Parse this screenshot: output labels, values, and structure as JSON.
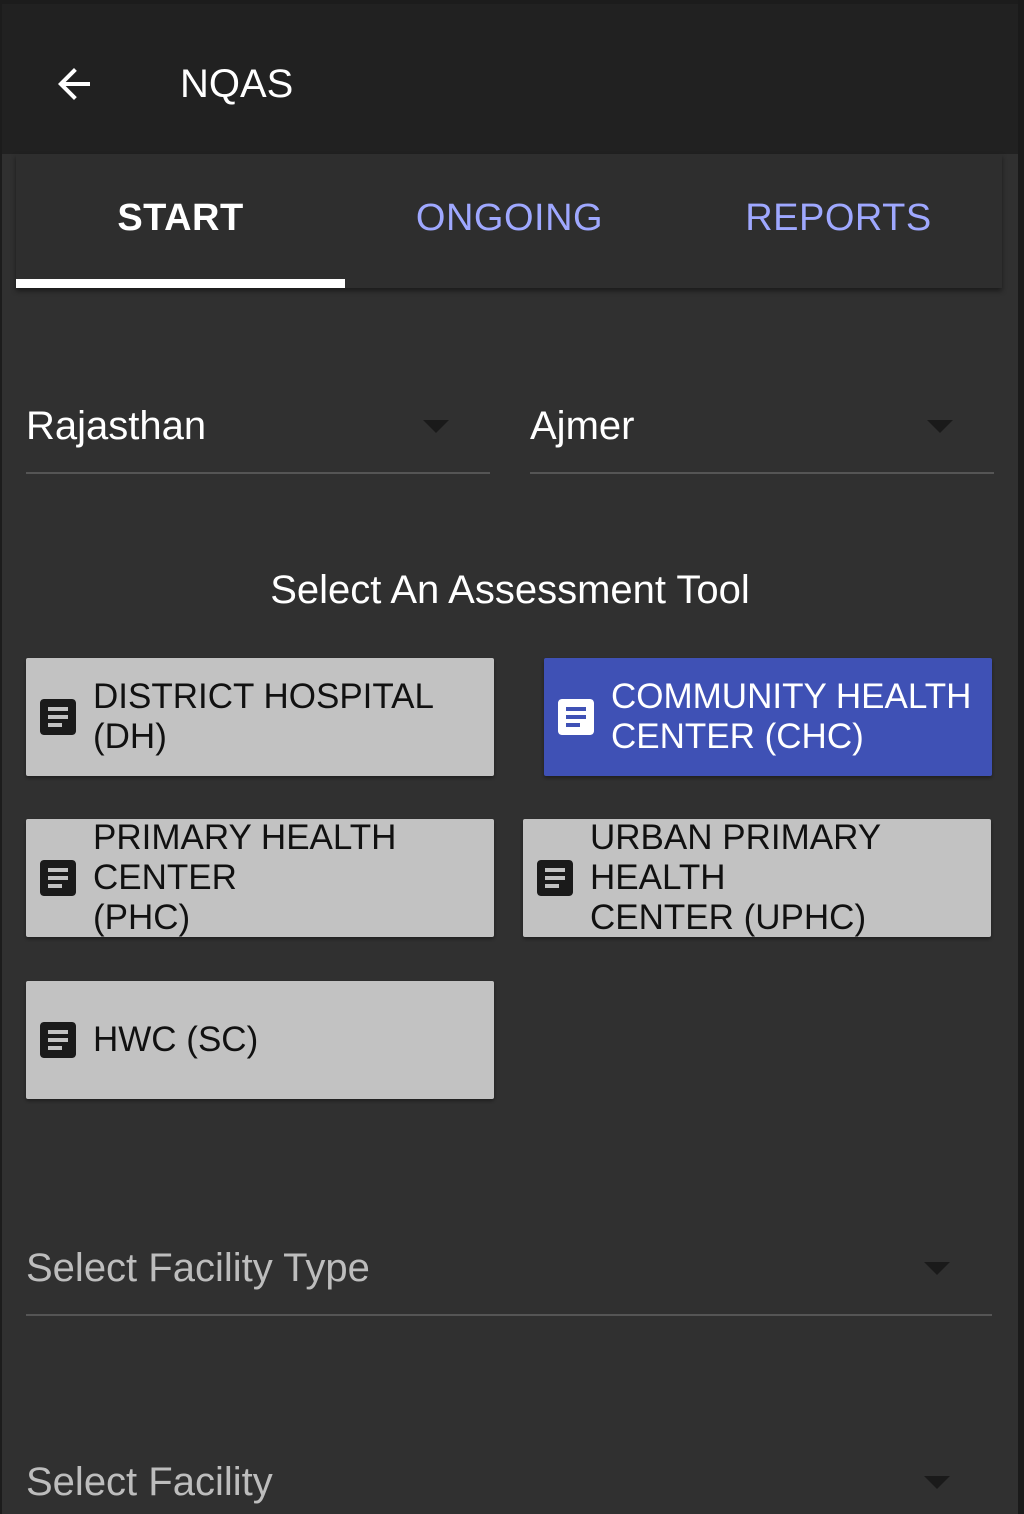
{
  "app_bar": {
    "title": "NQAS",
    "back_icon": "arrow-left-icon"
  },
  "tabs": [
    {
      "label": "START",
      "active": true
    },
    {
      "label": "ONGOING",
      "active": false
    },
    {
      "label": "REPORTS",
      "active": false
    }
  ],
  "filters": {
    "state": {
      "value": "Rajasthan"
    },
    "district": {
      "value": "Ajmer"
    }
  },
  "assessment": {
    "heading": "Select An Assessment Tool",
    "tools": [
      {
        "label": "DISTRICT HOSPITAL (DH)",
        "icon": "document-icon",
        "selected": false
      },
      {
        "label": "COMMUNITY HEALTH\nCENTER (CHC)",
        "icon": "document-icon",
        "selected": true
      },
      {
        "label": "PRIMARY HEALTH CENTER\n(PHC)",
        "icon": "document-icon",
        "selected": false
      },
      {
        "label": "URBAN PRIMARY HEALTH\nCENTER (UPHC)",
        "icon": "document-icon",
        "selected": false
      },
      {
        "label": "HWC (SC)",
        "icon": "document-icon",
        "selected": false
      }
    ]
  },
  "facility_type": {
    "placeholder": "Select Facility Type"
  },
  "facility": {
    "placeholder": "Select Facility"
  },
  "colors": {
    "background": "#303030",
    "app_bar": "#212121",
    "accent": "#3f51b5",
    "inactive_tab": "#9fa8ff",
    "tool_button": "#c2c2c2"
  }
}
